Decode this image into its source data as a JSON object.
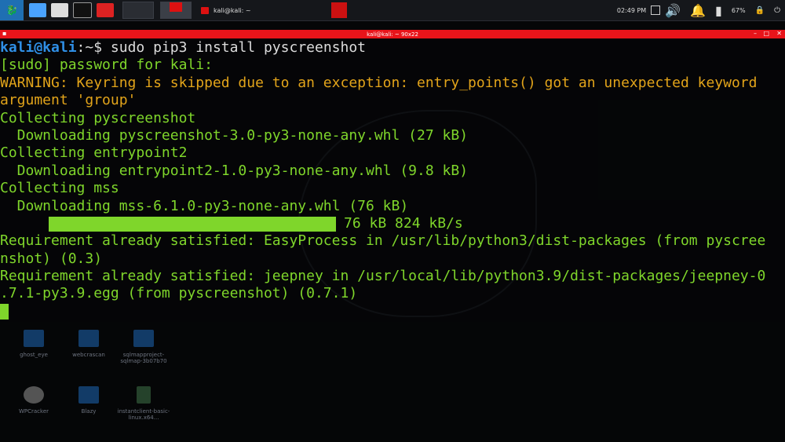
{
  "taskbar": {
    "task_label": "kali@kali: ~",
    "clock": "02:49 PM",
    "battery": "67%"
  },
  "window": {
    "title": "kali@kali: ~ 90x22"
  },
  "terminal": {
    "prompt_user": "kali@kali",
    "prompt_path": ":~$ ",
    "command": "sudo pip3 install pyscreenshot",
    "lines": [
      "[sudo] password for kali:",
      "WARNING: Keyring is skipped due to an exception: entry_points() got an unexpected keyword",
      "argument 'group'",
      "Collecting pyscreenshot",
      "  Downloading pyscreenshot-3.0-py3-none-any.whl (27 kB)",
      "Collecting entrypoint2",
      "  Downloading entrypoint2-1.0-py3-none-any.whl (9.8 kB)",
      "Collecting mss",
      "  Downloading mss-6.1.0-py3-none-any.whl (76 kB)"
    ],
    "progress_label": "76 kB 824 kB/s",
    "progress_fraction": 1.0,
    "lines_after": [
      "Requirement already satisfied: EasyProcess in /usr/lib/python3/dist-packages (from pyscree",
      "nshot) (0.3)",
      "Requirement already satisfied: jeepney in /usr/local/lib/python3.9/dist-packages/jeepney-0",
      ".7.1-py3.9.egg (from pyscreenshot) (0.7.1)"
    ]
  },
  "desktop": {
    "icons": [
      "ghost_eye",
      "webcrascan",
      "sqlmapproject-sqlmap-3b07b70",
      "WPCracker",
      "Blazy",
      "instantclient-basic-linux.x64..."
    ]
  },
  "colors": {
    "accent": "#e8141a",
    "terminal_green": "#7fd62b",
    "warning": "#e2a41a",
    "prompt": "#2f8fe6"
  }
}
